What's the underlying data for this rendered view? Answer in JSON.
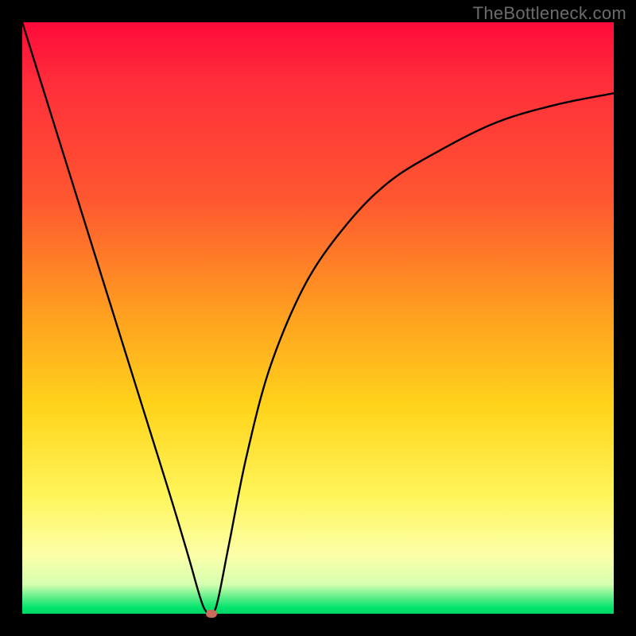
{
  "watermark": "TheBottleneck.com",
  "colors": {
    "frame": "#000000",
    "curve": "#000000",
    "marker": "#c96a5a",
    "gradient_stops": [
      "#ff0a3a",
      "#ff5730",
      "#ffa21f",
      "#ffd41a",
      "#fff55a",
      "#fcffa8",
      "#00e36b"
    ]
  },
  "chart_data": {
    "type": "line",
    "title": "",
    "xlabel": "",
    "ylabel": "",
    "xlim": [
      0,
      100
    ],
    "ylim": [
      0,
      100
    ],
    "x": [
      0,
      5,
      10,
      15,
      20,
      25,
      28,
      30,
      31,
      32,
      33,
      35,
      38,
      42,
      48,
      55,
      62,
      70,
      80,
      90,
      100
    ],
    "values": [
      100,
      84,
      68,
      52,
      36,
      20,
      10,
      3,
      0.5,
      0,
      2,
      12,
      27,
      42,
      56,
      66,
      73,
      78,
      83,
      86,
      88
    ],
    "optimum_x": 32,
    "optimum_y": 0,
    "note": "V-shaped bottleneck curve; minimum (optimum) near x≈32% where bottleneck ≈ 0%. Left branch is steep/linear, right branch asymptotically rises toward ~88%."
  }
}
